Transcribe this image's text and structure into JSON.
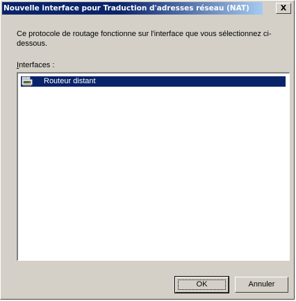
{
  "window": {
    "title": "Nouvelle interface pour Traduction d'adresses réseau (NAT)",
    "close_label": "X"
  },
  "content": {
    "description": "Ce protocole de routage fonctionne sur l'interface que vous sélectionnez ci-dessous.",
    "interfaces_label_accel": "I",
    "interfaces_label_rest": "nterfaces :"
  },
  "interfaces": {
    "items": [
      {
        "label": "Routeur distant",
        "icon": "router-interface-icon",
        "selected": true
      }
    ]
  },
  "buttons": {
    "ok_label": "OK",
    "cancel_label": "Annuler"
  },
  "colors": {
    "title_active": "#0a246a",
    "selection": "#0a246a",
    "face": "#d4d0c8"
  }
}
